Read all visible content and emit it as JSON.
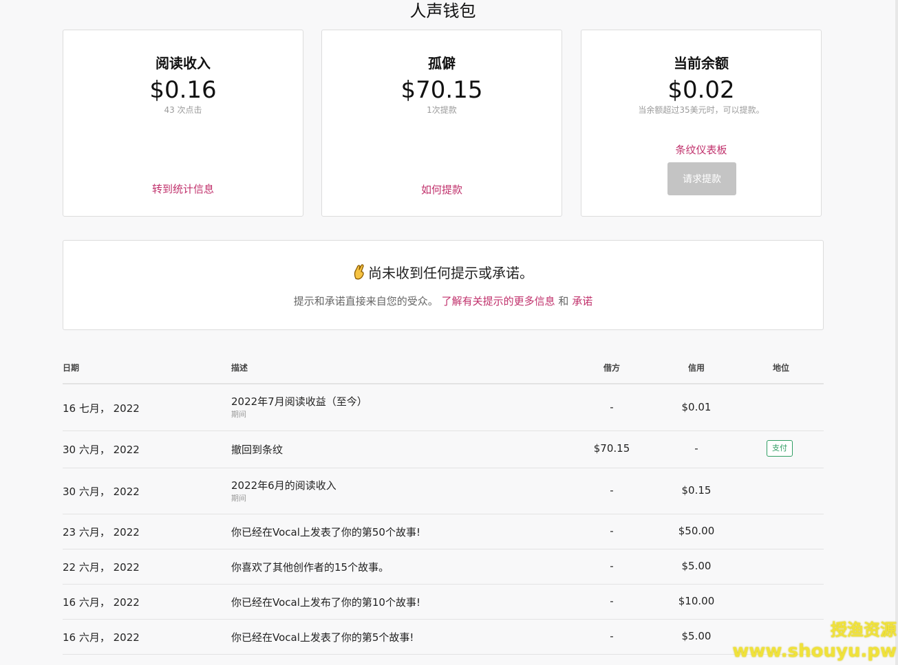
{
  "page": {
    "title": "人声钱包"
  },
  "cards": [
    {
      "title": "阅读收入",
      "amount": "$0.16",
      "sub": "43 次点击",
      "link": "转到统计信息"
    },
    {
      "title": "孤僻",
      "amount": "$70.15",
      "sub": "1次提款",
      "link": "如何提款"
    },
    {
      "title": "当前余额",
      "amount": "$0.02",
      "sub": "当余额超过35美元时，可以提款。",
      "link": "条纹仪表板",
      "button": "请求提款"
    }
  ],
  "tips": {
    "heading": "尚未收到任何提示或承诺。",
    "body": "提示和承诺直接来自您的受众。",
    "link1": "了解有关提示的更多信息",
    "and": "和",
    "link2": "承诺"
  },
  "table": {
    "headers": {
      "date": "日期",
      "desc": "描述",
      "debit": "借方",
      "credit": "信用",
      "status": "地位"
    },
    "rows": [
      {
        "date": "16 七月， 2022",
        "desc": "2022年7月阅读收益（至今）",
        "sub": "期间",
        "debit": "-",
        "credit": "$0.01",
        "status": ""
      },
      {
        "date": "30 六月， 2022",
        "desc": "撤回到条纹",
        "sub": "",
        "debit": "$70.15",
        "credit": "-",
        "status": "支付"
      },
      {
        "date": "30 六月， 2022",
        "desc": "2022年6月的阅读收入",
        "sub": "期间",
        "debit": "-",
        "credit": "$0.15",
        "status": ""
      },
      {
        "date": "23 六月， 2022",
        "desc": "你已经在Vocal上发表了你的第50个故事!",
        "sub": "",
        "debit": "-",
        "credit": "$50.00",
        "status": ""
      },
      {
        "date": "22 六月， 2022",
        "desc": "你喜欢了其他创作者的15个故事。",
        "sub": "",
        "debit": "-",
        "credit": "$5.00",
        "status": ""
      },
      {
        "date": "16 六月， 2022",
        "desc": "你已经在Vocal上发布了你的第10个故事!",
        "sub": "",
        "debit": "-",
        "credit": "$10.00",
        "status": ""
      },
      {
        "date": "16 六月， 2022",
        "desc": "你已经在Vocal上发表了你的第5个故事!",
        "sub": "",
        "debit": "-",
        "credit": "$5.00",
        "status": ""
      }
    ]
  },
  "watermark": {
    "line1": "授渔资源",
    "line2": "www.shouyu.pw"
  }
}
